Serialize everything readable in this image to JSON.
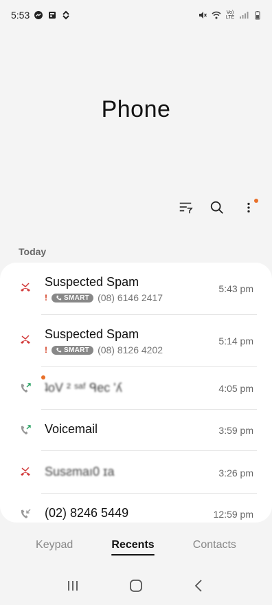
{
  "status_bar": {
    "time": "5:53",
    "network_label": "Vo)\nLTE"
  },
  "header": {
    "title": "Phone"
  },
  "toolbar": {
    "filter_icon": "filter-icon",
    "search_icon": "search-icon",
    "more_icon": "more-vert-icon"
  },
  "section": {
    "label": "Today"
  },
  "calls": [
    {
      "name": "Suspected Spam",
      "warning": "!",
      "badge": "SMART",
      "number": "(08) 6146 2417",
      "time": "5:43 pm",
      "type": "missed"
    },
    {
      "name": "Suspected Spam",
      "warning": "!",
      "badge": "SMART",
      "number": "(08) 8126 4202",
      "time": "5:14 pm",
      "type": "missed"
    },
    {
      "name": "ʇoV ² ˢᵃᶠ ᑫec 'ʎ",
      "time": "4:05 pm",
      "type": "outgoing"
    },
    {
      "name": "Voicemail",
      "time": "3:59 pm",
      "type": "outgoing"
    },
    {
      "name": "Susƨmaı0 ɪa",
      "time": "3:26 pm",
      "type": "missed"
    },
    {
      "name": "(02) 8246 5449",
      "time": "12:59 pm",
      "type": "incoming"
    }
  ],
  "tabs": [
    {
      "label": "Keypad"
    },
    {
      "label": "Recents"
    },
    {
      "label": "Contacts"
    }
  ],
  "colors": {
    "missed": "#d23a3a",
    "outgoing": "#2aa364",
    "accent_dot": "#e8702a"
  }
}
